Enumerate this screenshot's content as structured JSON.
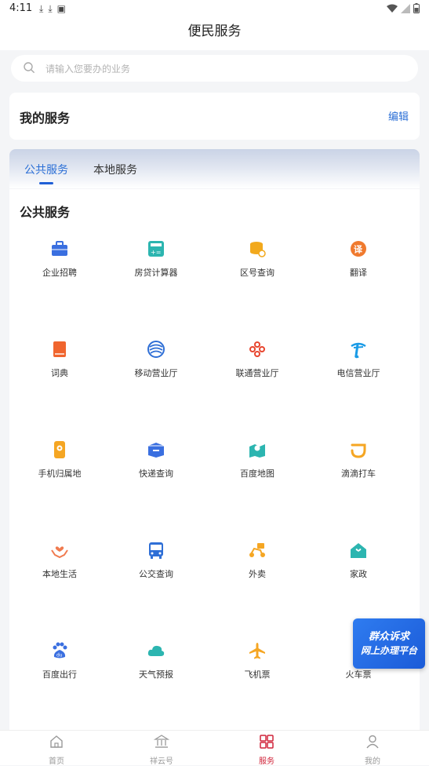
{
  "status": {
    "time": "4:11"
  },
  "header": {
    "title": "便民服务"
  },
  "search": {
    "placeholder": "请输入您要办的业务"
  },
  "my_services": {
    "title": "我的服务",
    "edit_label": "编辑"
  },
  "tabs": [
    {
      "label": "公共服务",
      "active": true
    },
    {
      "label": "本地服务",
      "active": false
    }
  ],
  "panel": {
    "title": "公共服务"
  },
  "services": [
    {
      "label": "企业招聘",
      "icon": "briefcase-icon",
      "color": "#3a6fe0"
    },
    {
      "label": "房贷计算器",
      "icon": "calculator-icon",
      "color": "#2cb5b0"
    },
    {
      "label": "区号查询",
      "icon": "coins-icon",
      "color": "#f2a91d"
    },
    {
      "label": "翻译",
      "icon": "translate-icon",
      "color": "#f07a2e"
    },
    {
      "label": "词典",
      "icon": "book-icon",
      "color": "#f0652e"
    },
    {
      "label": "移动营业厅",
      "icon": "china-mobile-icon",
      "color": "#2f6fd6"
    },
    {
      "label": "联通营业厅",
      "icon": "china-unicom-icon",
      "color": "#e8452e"
    },
    {
      "label": "电信营业厅",
      "icon": "china-telecom-icon",
      "color": "#1a9be6"
    },
    {
      "label": "手机归属地",
      "icon": "phone-location-icon",
      "color": "#f5a623"
    },
    {
      "label": "快递查询",
      "icon": "package-icon",
      "color": "#3a6fe0"
    },
    {
      "label": "百度地图",
      "icon": "map-icon",
      "color": "#2cb5b0"
    },
    {
      "label": "滴滴打车",
      "icon": "didi-icon",
      "color": "#f5a623"
    },
    {
      "label": "本地生活",
      "icon": "hands-heart-icon",
      "color": "#f07a4e"
    },
    {
      "label": "公交查询",
      "icon": "bus-icon",
      "color": "#2f6fd6"
    },
    {
      "label": "外卖",
      "icon": "scooter-icon",
      "color": "#f5a623"
    },
    {
      "label": "家政",
      "icon": "house-icon",
      "color": "#2cb5b0"
    },
    {
      "label": "百度出行",
      "icon": "baidu-paw-icon",
      "color": "#3a6fe0"
    },
    {
      "label": "天气预报",
      "icon": "cloud-icon",
      "color": "#2cb5b0"
    },
    {
      "label": "飞机票",
      "icon": "airplane-icon",
      "color": "#f5a623"
    },
    {
      "label": "火车票",
      "icon": "train-icon",
      "color": "#2f6fd6"
    }
  ],
  "float_banner": {
    "line1": "群众诉求",
    "line2": "网上办理平台"
  },
  "bottom_nav": [
    {
      "label": "首页",
      "icon": "home-icon",
      "active": false
    },
    {
      "label": "祥云号",
      "icon": "institution-icon",
      "active": false
    },
    {
      "label": "服务",
      "icon": "grid-icon",
      "active": true
    },
    {
      "label": "我的",
      "icon": "user-icon",
      "active": false
    }
  ]
}
